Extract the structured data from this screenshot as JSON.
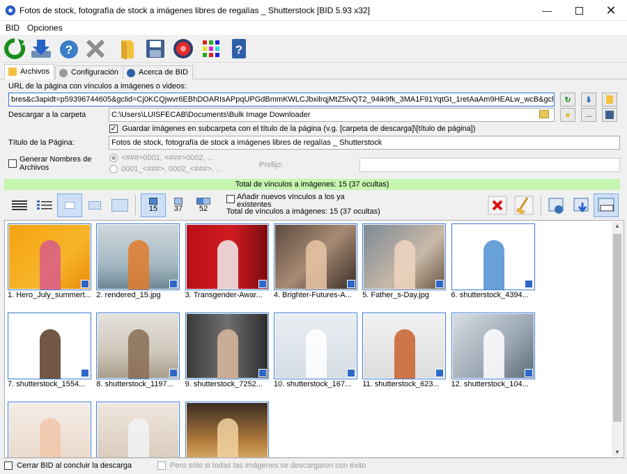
{
  "window": {
    "title": "Fotos de stock, fotografía de stock a imágenes libres de regalías _ Shutterstock [BID 5.93 x32]"
  },
  "menu": [
    "BID",
    "Opciones"
  ],
  "toolbar_icons": [
    "refresh-icon",
    "download-icon",
    "help-icon",
    "stop-icon",
    "folder-icon",
    "save-icon",
    "settings-gear-icon",
    "grid-icon",
    "info-icon"
  ],
  "tabs": [
    {
      "label": "Archivos",
      "icon": "folder-icon"
    },
    {
      "label": "Configuración",
      "icon": "gear-icon"
    },
    {
      "label": "Acerca de BID",
      "icon": "info-icon"
    }
  ],
  "form": {
    "url_label": "URL de la página con vínculos a imágenes o videos:",
    "url_value": "bres&c3apidt=p59396744605&gclid=Cj0KCQjwvr6EBhDOARIsAPpqUPGdBmmKWLCJbxilrqjMtZ5ivQT2_94ik9fk_3MA1F91YqtGt_1retAaAm9HEALw_wcB&gclsrc=aw.ds",
    "folder_label": "Descargar a la carpeta",
    "folder_value": "C:\\Users\\LUISFECAB\\Documents\\Bulk Image Downloader",
    "subfolder_checkbox": "Guardar imágenes en subcarpeta con el título de la página (v.g. [carpeta de descarga]\\[título de página])",
    "page_title_label": "Título de la Página:",
    "page_title_value": "Fotos de stock, fotografía de stock a imágenes libres de regalías _ Shutterstock",
    "gen_names_checkbox": "Generar Nombres de Archivos",
    "radio1": "<###>0001, <###>0002, ...",
    "radio2": "0001_<###>, 0002_<###>, ...",
    "prefix_label": "Prefijo:",
    "more_button": "..."
  },
  "status": "Total de vínculos a imágenes: 15 (37 ocultas)",
  "counts": [
    {
      "value": "15"
    },
    {
      "value": "37"
    },
    {
      "value": "52"
    }
  ],
  "add_new_checkbox": "Añadir nuevos vínculos a los ya existentes",
  "total_links": "Total de vínculos a imágenes: 15 (37 ocultas)",
  "images": [
    {
      "caption": "1. Hero_July_summert...",
      "bg": "linear-gradient(135deg,#f4a30f,#f7b52a 60%,#e98c0a)",
      "fg": "#d95c8b"
    },
    {
      "caption": "2. rendered_15.jpg",
      "bg": "linear-gradient(180deg,#cfd8dc,#a7bac4 60%,#6d8794)",
      "fg": "#e07b2a"
    },
    {
      "caption": "3. Transgender-Awar...",
      "bg": "linear-gradient(90deg,#b80f16,#d11d22 55%,#7a0a0e)",
      "fg": "#eee"
    },
    {
      "caption": "4. Brighter-Futures-A...",
      "bg": "linear-gradient(135deg,#5c4a3e,#a78b74 50%,#3b2f28)",
      "fg": "#e8c5a5"
    },
    {
      "caption": "5. Father_s-Day.jpg",
      "bg": "linear-gradient(135deg,#7c8a96,#c9b9a8 60%,#6b5845)",
      "fg": "#f0d5c0"
    },
    {
      "caption": "6. shutterstock_4394...",
      "bg": "#ffffff",
      "fg": "#4d8fd1"
    },
    {
      "caption": "7. shutterstock_1554...",
      "bg": "#ffffff",
      "fg": "#5b3a25"
    },
    {
      "caption": "8. shutterstock_1197...",
      "bg": "linear-gradient(180deg,#e4e1dc,#cfc7bb 60%,#a89c8b)",
      "fg": "#8a6d55"
    },
    {
      "caption": "9. shutterstock_7252...",
      "bg": "linear-gradient(90deg,#3a3a3a,#6f6f6f 50%,#2d2d2d)",
      "fg": "#d9b99b"
    },
    {
      "caption": "10. shutterstock_167...",
      "bg": "linear-gradient(180deg,#e9eef2,#d5dde4)",
      "fg": "#fff"
    },
    {
      "caption": "11. shutterstock_623...",
      "bg": "linear-gradient(180deg,#f2f2f2,#dcdcdc)",
      "fg": "#c9622e"
    },
    {
      "caption": "12. shutterstock_104...",
      "bg": "linear-gradient(135deg,#d8dde2,#9aa7b3 60%,#5d6b78)",
      "fg": "#fff"
    },
    {
      "caption": "",
      "bg": "linear-gradient(180deg,#f4ece6,#e9d6c8)",
      "fg": "#f1c7a9"
    },
    {
      "caption": "",
      "bg": "linear-gradient(180deg,#efe7df,#d7c7b8)",
      "fg": "#f3f3f3"
    },
    {
      "caption": "",
      "bg": "linear-gradient(180deg,#3a2c22,#b37b3d 60%,#e8c07a)",
      "fg": "#f1d2a0"
    }
  ],
  "footer": {
    "close_checkbox": "Cerrar BID al concluir la descarga",
    "only_if_checkbox": "Pero sólo si todas las imágenes se descargaron con éxito"
  }
}
